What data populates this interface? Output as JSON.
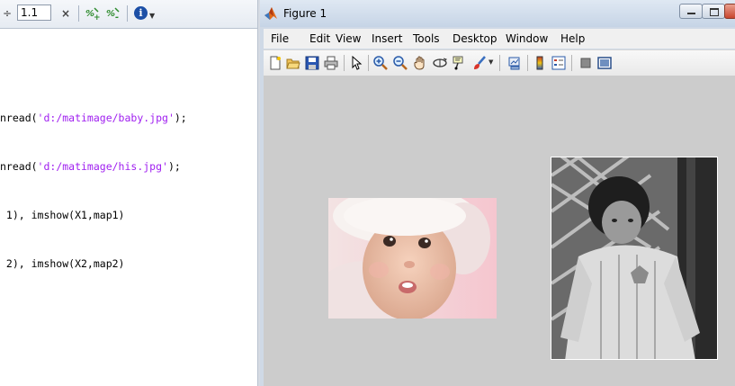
{
  "editor": {
    "toolbar": {
      "step_symbol": "÷",
      "step_value": "1.1",
      "close_symbol": "×",
      "icons": [
        "increment-icon",
        "decrement-icon",
        "info-icon"
      ]
    },
    "code_lines": [
      {
        "prefix": "nread(",
        "string": "'d:/matimage/baby.jpg'",
        "suffix": ");"
      },
      {
        "prefix": "nread(",
        "string": "'d:/matimage/his.jpg'",
        "suffix": ");"
      },
      {
        "text": " 1), imshow(X1,map1)"
      },
      {
        "text": " 2), imshow(X2,map2)"
      }
    ]
  },
  "figure": {
    "title": "Figure 1",
    "menus": [
      "File",
      "Edit",
      "View",
      "Insert",
      "Tools",
      "Desktop",
      "Window",
      "Help"
    ],
    "toolbar_icons": [
      "new-figure-icon",
      "open-file-icon",
      "save-icon",
      "print-icon",
      "edit-plot-arrow-icon",
      "zoom-in-icon",
      "zoom-out-icon",
      "pan-icon",
      "rotate-3d-icon",
      "data-cursor-icon",
      "brush-icon",
      "link-plot-icon",
      "colorbar-icon",
      "legend-icon",
      "hide-plot-tools-icon",
      "show-plot-tools-icon"
    ],
    "images": [
      {
        "name": "baby-photo",
        "tone": "color"
      },
      {
        "name": "his-photo",
        "tone": "grayscale"
      }
    ]
  }
}
